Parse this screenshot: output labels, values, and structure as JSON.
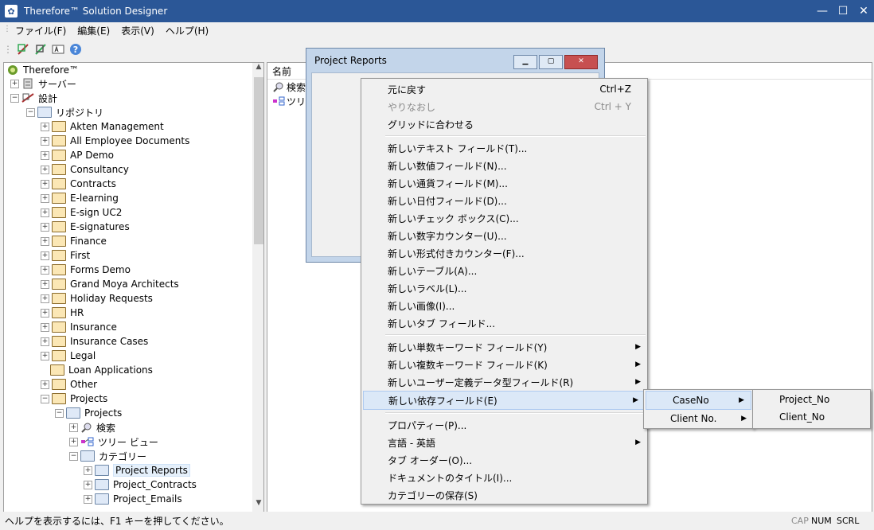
{
  "window": {
    "title": "Therefore™ Solution Designer",
    "min": "—",
    "max": "☐",
    "close": "✕"
  },
  "menubar": [
    "ファイル(F)",
    "編集(E)",
    "表示(V)",
    "ヘルプ(H)"
  ],
  "tree": {
    "root": "Therefore™",
    "server": "サーバー",
    "design": "設計",
    "repository": "リポジトリ",
    "repo_items": [
      "Akten Management",
      "All Employee Documents",
      "AP Demo",
      "Consultancy",
      "Contracts",
      "E-learning",
      "E-sign UC2",
      "E-signatures",
      "Finance",
      "First",
      "Forms Demo",
      "Grand Moya Architects",
      "Holiday Requests",
      "HR",
      "Insurance",
      "Insurance Cases",
      "Legal",
      "Loan Applications",
      "Other",
      "Projects"
    ],
    "projects_sub": "Projects",
    "search": "検索",
    "treeview": "ツリー ビュー",
    "category": "カテゴリー",
    "categories": [
      "Project Reports",
      "Project_Contracts",
      "Project_Emails"
    ]
  },
  "right_pane": {
    "header": "名前",
    "items": [
      "検索",
      "ツリ"
    ]
  },
  "dialog": {
    "title": "Project Reports"
  },
  "context_menu": {
    "groups": [
      [
        {
          "label": "元に戻す",
          "shortcut": "Ctrl+Z"
        },
        {
          "label": "やりなおし",
          "shortcut": "Ctrl + Y",
          "disabled": true
        },
        {
          "label": "グリッドに合わせる"
        }
      ],
      [
        {
          "label": "新しいテキスト フィールド(T)..."
        },
        {
          "label": "新しい数値フィールド(N)..."
        },
        {
          "label": "新しい通貨フィールド(M)..."
        },
        {
          "label": "新しい日付フィールド(D)..."
        },
        {
          "label": "新しいチェック ボックス(C)..."
        },
        {
          "label": "新しい数字カウンター(U)..."
        },
        {
          "label": "新しい形式付きカウンター(F)..."
        },
        {
          "label": "新しいテーブル(A)..."
        },
        {
          "label": "新しいラベル(L)..."
        },
        {
          "label": "新しい画像(I)..."
        },
        {
          "label": "新しいタブ フィールド..."
        }
      ],
      [
        {
          "label": "新しい単数キーワード フィールド(Y)",
          "submenu": true
        },
        {
          "label": "新しい複数キーワード フィールド(K)",
          "submenu": true
        },
        {
          "label": "新しいユーザー定義データ型フィールド(R)",
          "submenu": true
        },
        {
          "label": "新しい依存フィールド(E)",
          "submenu": true,
          "highlighted": true
        }
      ],
      [
        {
          "label": "プロパティー(P)..."
        },
        {
          "label": "言語 - 英語",
          "submenu": true
        },
        {
          "label": "タブ オーダー(O)..."
        },
        {
          "label": "ドキュメントのタイトル(I)..."
        },
        {
          "label": "カテゴリーの保存(S)"
        }
      ]
    ]
  },
  "submenu1": [
    {
      "label": "CaseNo",
      "highlighted": true
    },
    {
      "label": "Client No."
    }
  ],
  "submenu2": [
    {
      "label": "Project_No"
    },
    {
      "label": "Client_No"
    }
  ],
  "statusbar": {
    "message": "ヘルプを表示するには、F1 キーを押してください。",
    "cap": "CAP",
    "num": "NUM",
    "scrl": "SCRL"
  }
}
